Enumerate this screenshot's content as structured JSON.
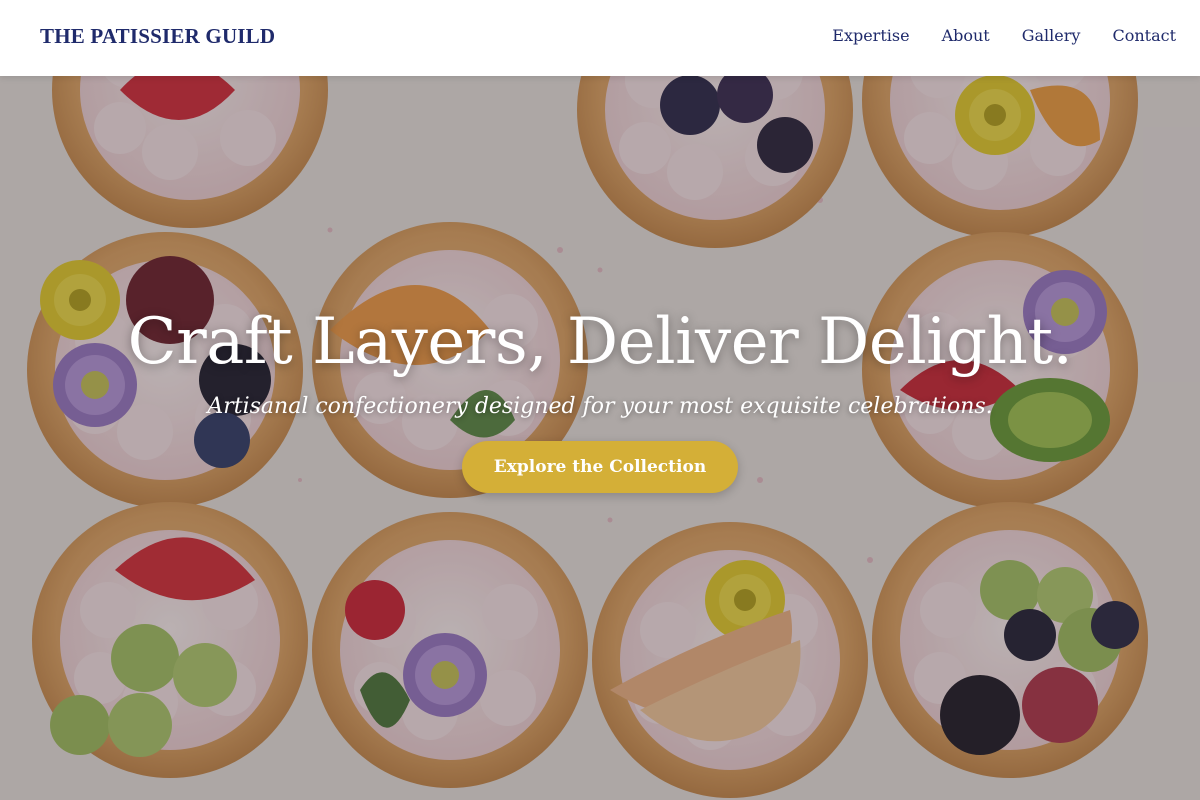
{
  "header": {
    "logo": "THE PATISSIER GUILD",
    "nav": [
      {
        "label": "Expertise"
      },
      {
        "label": "About"
      },
      {
        "label": "Gallery"
      },
      {
        "label": "Contact"
      }
    ]
  },
  "hero": {
    "title": "Craft Layers, Deliver Delight.",
    "subtitle": "Artisanal confectionery designed for your most exquisite celebrations.",
    "cta_label": "Explore the Collection",
    "background_image": "tartlets-with-fruit-and-flowers"
  },
  "colors": {
    "brand_navy": "#1f2a6b",
    "cta_gold": "#d4af37",
    "header_bg": "#ffffff"
  }
}
